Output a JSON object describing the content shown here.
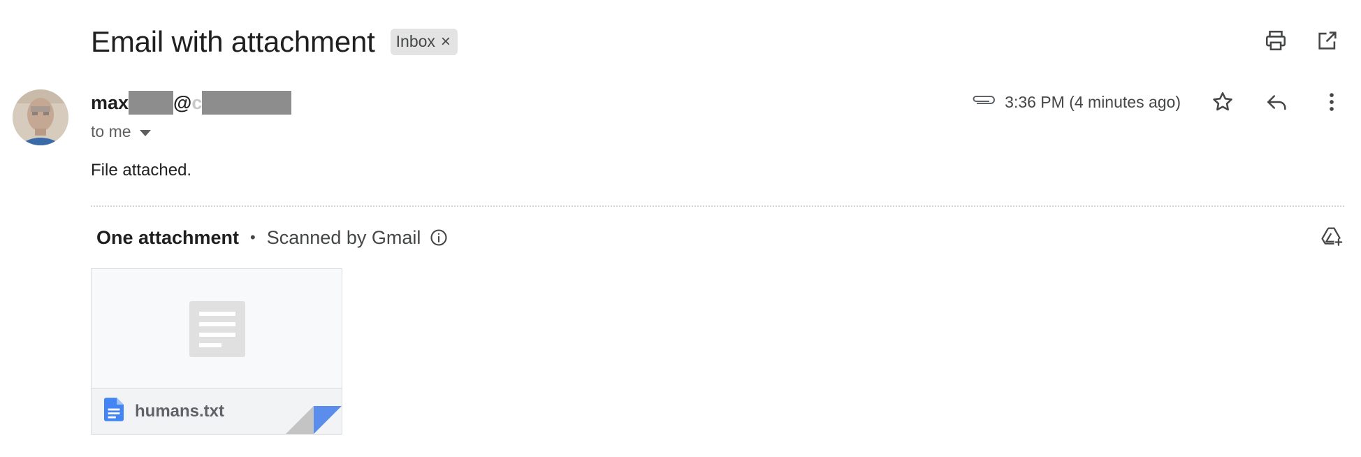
{
  "email": {
    "subject": "Email with attachment",
    "label": "Inbox",
    "label_remove": "×",
    "sender": {
      "name_prefix": "max",
      "at": "@",
      "partial": "c"
    },
    "recipient": "to me",
    "timestamp": "3:36 PM (4 minutes ago)",
    "body": "File attached."
  },
  "attachments": {
    "count_label": "One attachment",
    "separator": "•",
    "scanned_label": "Scanned by Gmail",
    "files": [
      {
        "name": "humans.txt",
        "type": "text document"
      }
    ]
  },
  "icons": {
    "print": "print-icon",
    "open_new_window": "open-in-new-icon",
    "attachment": "paperclip-icon",
    "star": "star-icon",
    "reply": "reply-icon",
    "more": "more-vert-icon",
    "info": "info-icon",
    "add_to_drive": "add-to-drive-icon"
  },
  "colors": {
    "file_icon": "#4285f4",
    "chip_bg": "#e3e3e3",
    "redaction": "#8d8d8d"
  }
}
